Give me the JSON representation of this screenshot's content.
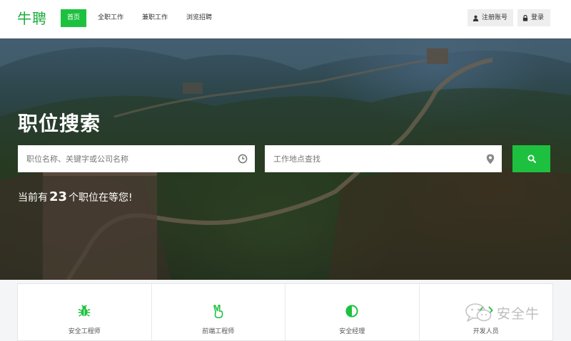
{
  "header": {
    "logo": "牛聘",
    "nav": [
      {
        "label": "首页",
        "active": true
      },
      {
        "label": "全职工作",
        "active": false
      },
      {
        "label": "兼职工作",
        "active": false
      },
      {
        "label": "浏览招聘",
        "active": false
      }
    ],
    "register_label": "注册账号",
    "login_label": "登录"
  },
  "hero": {
    "title": "职位搜索",
    "keyword_placeholder": "职位名称、关键字或公司名称",
    "keyword_icon": "clock-icon",
    "location_placeholder": "工作地点查找",
    "location_icon": "map-pin-icon",
    "search_icon": "search-icon",
    "count_prefix": "当前有",
    "count": "23",
    "count_suffix": "个职位在等您!"
  },
  "categories": [
    {
      "label": "安全工程师",
      "icon": "bug-icon"
    },
    {
      "label": "前端工程师",
      "icon": "peace-hand-icon"
    },
    {
      "label": "安全经理",
      "icon": "contrast-icon"
    },
    {
      "label": "开发人员",
      "icon": "code-icon"
    }
  ],
  "watermark": {
    "text": "安全牛"
  },
  "colors": {
    "accent": "#1ec13f",
    "logo": "#1aad3c"
  }
}
